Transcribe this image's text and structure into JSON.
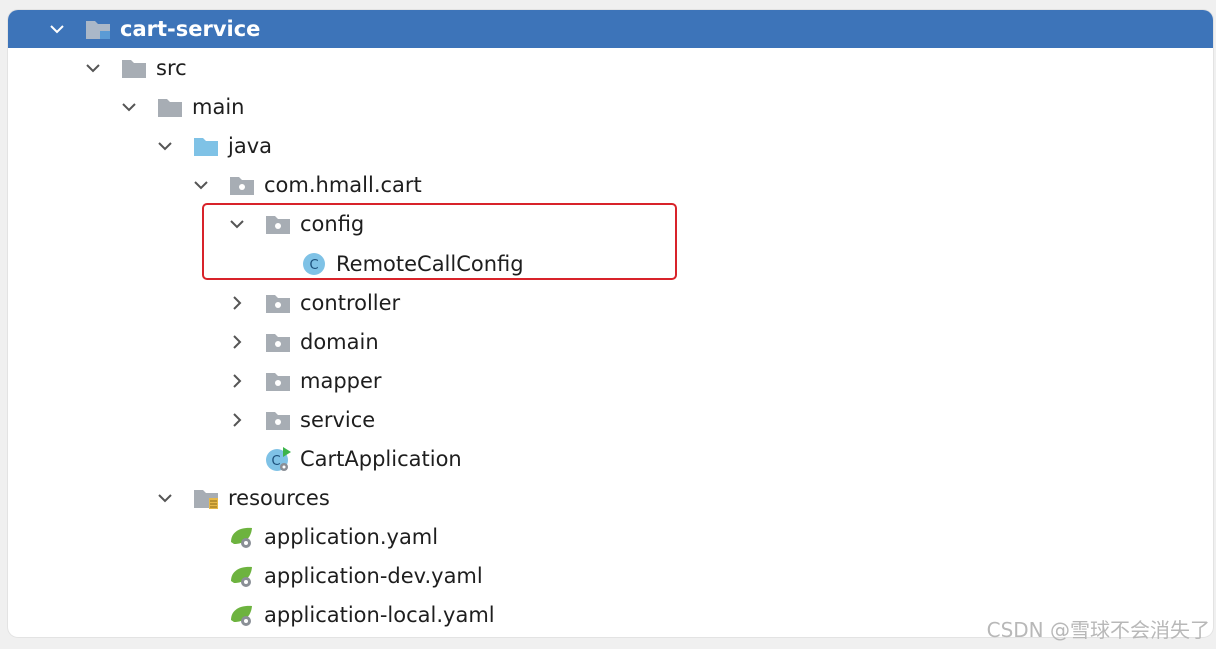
{
  "tree": {
    "root": {
      "label": "cart-service",
      "icon": "module-folder-icon",
      "expanded": true
    },
    "items": [
      {
        "label": "src",
        "icon": "folder-icon",
        "expanded": true
      },
      {
        "label": "main",
        "icon": "folder-icon",
        "expanded": true
      },
      {
        "label": "java",
        "icon": "source-folder-icon",
        "expanded": true
      },
      {
        "label": "com.hmall.cart",
        "icon": "package-icon",
        "expanded": true
      },
      {
        "label": "config",
        "icon": "package-icon",
        "expanded": true
      },
      {
        "label": "RemoteCallConfig",
        "icon": "class-icon"
      },
      {
        "label": "controller",
        "icon": "package-icon",
        "expanded": false
      },
      {
        "label": "domain",
        "icon": "package-icon",
        "expanded": false
      },
      {
        "label": "mapper",
        "icon": "package-icon",
        "expanded": false
      },
      {
        "label": "service",
        "icon": "package-icon",
        "expanded": false
      },
      {
        "label": "CartApplication",
        "icon": "spring-boot-application-icon"
      },
      {
        "label": "resources",
        "icon": "resources-folder-icon",
        "expanded": true
      },
      {
        "label": "application.yaml",
        "icon": "spring-yaml-icon"
      },
      {
        "label": "application-dev.yaml",
        "icon": "spring-yaml-icon"
      },
      {
        "label": "application-local.yaml",
        "icon": "spring-yaml-icon"
      }
    ]
  },
  "colors": {
    "selection": "#3d74b9",
    "highlight_border": "#d8232a"
  },
  "watermark": "CSDN @雪球不会消失了"
}
